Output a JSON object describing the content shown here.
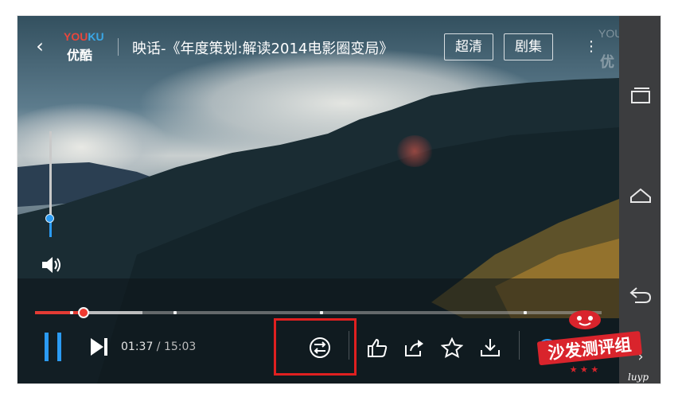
{
  "header": {
    "back_label": "‹",
    "logo_en_a": "YOU",
    "logo_en_b": "KU",
    "logo_zh": "优酷",
    "title": "映话-《年度策划:解读2014电影圈变局》",
    "hd_label": "超清",
    "episodes_label": "剧集",
    "more_label": "⋮",
    "watermark_en": "YOUKU",
    "watermark_zh": "优"
  },
  "player": {
    "current_time": "01:37",
    "separator": " / ",
    "total_time": "15:03",
    "progress_fraction": 0.086,
    "buffer_fraction": 0.19,
    "volume_fraction": 0.18
  },
  "controls": {
    "play_state": "paused-playing",
    "icons": [
      "pause-icon",
      "next-icon",
      "cast-switch-icon",
      "like-icon",
      "share-icon",
      "favorite-icon",
      "download-icon",
      "lock-icon"
    ]
  },
  "system_nav": {
    "icons": [
      "recent-apps-icon",
      "home-icon",
      "back-icon"
    ]
  },
  "stamp": {
    "text": "沙发测评组",
    "stars": "★ ★ ★",
    "signature": "luyp"
  },
  "colors": {
    "accent_blue": "#2b9bf3",
    "progress_red": "#e43b34",
    "highlight_box": "#e02020"
  }
}
